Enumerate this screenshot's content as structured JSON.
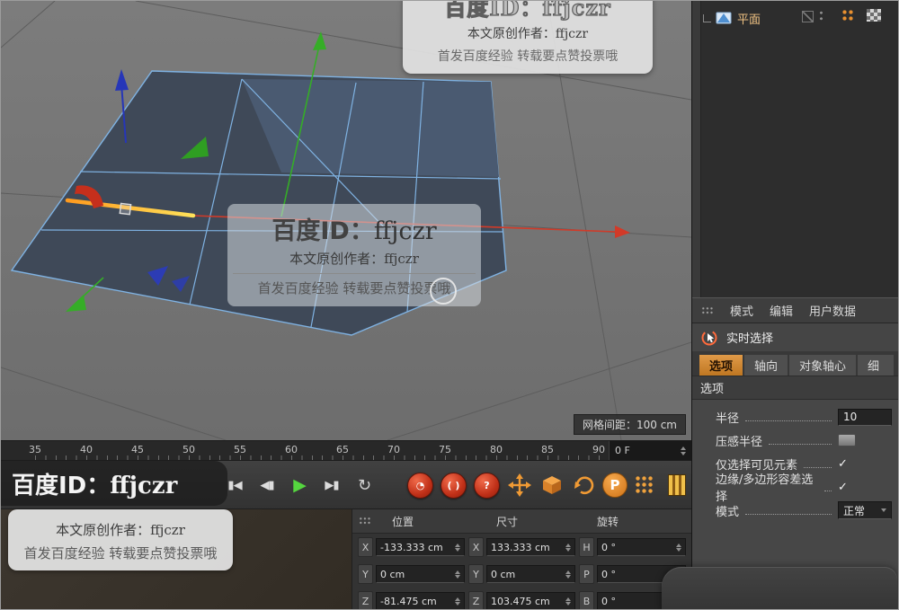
{
  "colors": {
    "accent_orange": "#cf7c28",
    "axis_red": "#d23a28",
    "axis_green": "#35ad27",
    "axis_blue": "#2636b8",
    "wire_blue": "#7fb2e2",
    "plane_fill": "#3f4958"
  },
  "watermark": {
    "line1": "百度ID：ffjczr",
    "line1_prefix": "百度ID：",
    "line1_id": "ffjczr",
    "line2": "本文原创作者：ffjczr",
    "line3": "首发百度经验 转载要点赞投票哦"
  },
  "viewport": {
    "grid_label": "网格间距：100 cm"
  },
  "timeline": {
    "ticks": [
      "35",
      "40",
      "45",
      "50",
      "55",
      "60",
      "65",
      "70",
      "75",
      "80",
      "85",
      "90"
    ],
    "frame": "0 F"
  },
  "transport": {
    "buttons": [
      "▮◀",
      "◀▮",
      "▶",
      "▶▮",
      "↻"
    ],
    "records": [
      "◔",
      "( )",
      "?"
    ],
    "p": "P"
  },
  "coordinates": {
    "headers": [
      "位置",
      "尺寸",
      "旋转"
    ],
    "rows": [
      {
        "l1": "X",
        "v1": "-133.333 cm",
        "l2": "X",
        "v2": "133.333 cm",
        "l3": "H",
        "v3": "0 °"
      },
      {
        "l1": "Y",
        "v1": "0 cm",
        "l2": "Y",
        "v2": "0 cm",
        "l3": "P",
        "v3": "0 °"
      },
      {
        "l1": "Z",
        "v1": "-81.475 cm",
        "l2": "Z",
        "v2": "103.475 cm",
        "l3": "B",
        "v3": "0 °"
      }
    ]
  },
  "object_manager": {
    "item_label": "平面"
  },
  "attributes": {
    "menu": [
      "模式",
      "编辑",
      "用户数据"
    ],
    "tool_label": "实时选择",
    "tabs": [
      "选项",
      "轴向",
      "对象轴心",
      "细"
    ],
    "section_title": "选项",
    "radius_label": "半径",
    "radius_value": "10",
    "pressure_label": "压感半径",
    "visible_label": "仅选择可见元素",
    "tolerance_label": "边缘/多边形容差选择",
    "check": "✓",
    "mode_label": "模式",
    "mode_value": "正常"
  }
}
